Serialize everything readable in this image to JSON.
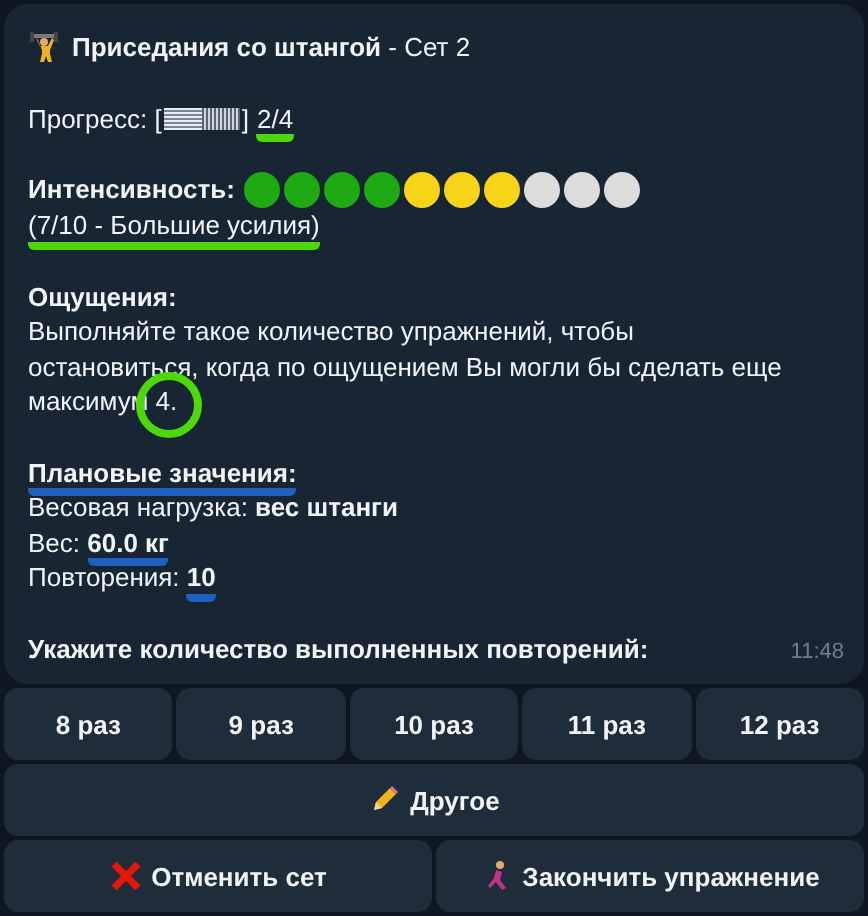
{
  "message": {
    "sections": [
      {
        "lines": [
          {
            "kind": "title",
            "text": "**Приседания со штангой** - Сет 2"
          }
        ]
      },
      {
        "lines": [
          {
            "kind": "progress",
            "label": "Прогресс: ",
            "open": "[",
            "close": "]",
            "level": 0.5,
            "value": "2/4",
            "underlined": true
          }
        ]
      },
      {
        "lines": [
          {
            "kind": "dots",
            "label": "Интенсивность:",
            "dots": [
              {
                "color": "#1faa12"
              },
              {
                "color": "#1faa12"
              },
              {
                "color": "#1faa12"
              },
              {
                "color": "#1faa12"
              },
              {
                "color": "#f7d31a"
              },
              {
                "color": "#f7d31a"
              },
              {
                "color": "#f7d31a"
              },
              {
                "color": "#dcdcdc"
              },
              {
                "color": "#dcdcdc"
              },
              {
                "color": "#dcdcdc"
              }
            ]
          },
          {
            "kind": "text",
            "segments": [
              {
                "kind": "plain",
                "text": "(7/10 - Большие усилия)",
                "underlined": true
              }
            ]
          }
        ]
      },
      {
        "lines": [
          {
            "kind": "text",
            "segments": [
              {
                "kind": "heading",
                "text": "Ощущения:",
                "underlined": false
              }
            ]
          },
          {
            "kind": "paragraph",
            "text": "Выполняйте такое количество упражнений, чтобы остановиться, когда по ощущением Вы могли бы сделать еще максимум 4.",
            "circled": true
          }
        ]
      },
      {
        "lines": [
          {
            "kind": "text",
            "segments": [
              {
                "kind": "heading",
                "text": "Плановые значения:",
                "underlined": true
              }
            ]
          },
          {
            "kind": "text",
            "segments": [
              {
                "kind": "plain",
                "text": "Весовая нагрузка: ",
                "underlined": false
              },
              {
                "kind": "value",
                "text": "вес штанги",
                "underlined": false
              }
            ]
          },
          {
            "kind": "text",
            "segments": [
              {
                "kind": "plain",
                "text": "Вес: ",
                "underlined": false
              },
              {
                "kind": "value",
                "text": "60.0 кг",
                "underlined": true
              }
            ]
          },
          {
            "kind": "text",
            "segments": [
              {
                "kind": "plain",
                "text": "Повторения: ",
                "underlined": false
              },
              {
                "kind": "value",
                "text": "10",
                "underlined": true
              }
            ]
          }
        ]
      },
      {
        "lines": [
          {
            "kind": "text",
            "segments": [
              {
                "kind": "heading",
                "text": "Укажите количество выполненных повторений:",
                "underlined": false
              }
            ]
          }
        ]
      }
    ],
    "time": "11:48"
  },
  "keyboard": [
    [
      {
        "text": "8 раз"
      },
      {
        "text": "9 раз"
      },
      {
        "text": "10 раз"
      },
      {
        "text": "11 раз"
      },
      {
        "text": "12 раз"
      }
    ],
    [
      {
        "kind": "edit",
        "text": "Другое"
      }
    ],
    [
      {
        "kind": "cancel",
        "text": "Отменить сет"
      },
      {
        "kind": "finish",
        "text": "Закончить упражнение"
      }
    ]
  ]
}
